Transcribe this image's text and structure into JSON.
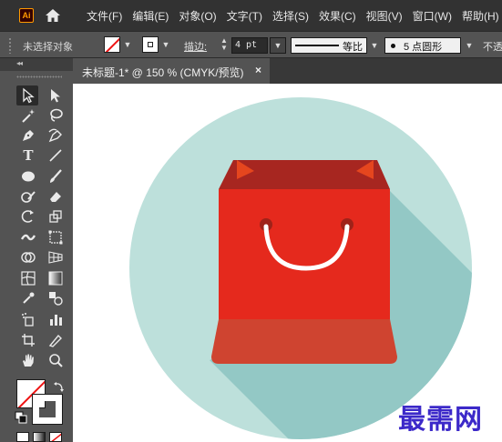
{
  "app": {
    "logo_text": "Ai",
    "menu": [
      "文件(F)",
      "编辑(E)",
      "对象(O)",
      "文字(T)",
      "选择(S)",
      "效果(C)",
      "视图(V)",
      "窗口(W)",
      "帮助(H)"
    ]
  },
  "control_bar": {
    "selection_status": "未选择对象",
    "stroke_label": "描边",
    "stroke_colon": ":",
    "stroke_weight": "4 pt",
    "profile_label": "等比",
    "brush_label": "5 点圆形",
    "opacity_label": "不透"
  },
  "document": {
    "tab_title": "未标题-1* @ 150 % (CMYK/预览)",
    "close_glyph": "×"
  },
  "tools": [
    "selection-tool",
    "direct-selection-tool",
    "magic-wand-tool",
    "lasso-tool",
    "pen-tool",
    "curvature-tool",
    "type-tool",
    "line-segment-tool",
    "ellipse-tool",
    "paintbrush-tool",
    "shaper-tool",
    "eraser-tool",
    "rotate-tool",
    "scale-tool",
    "width-tool",
    "free-transform-tool",
    "shape-builder-tool",
    "perspective-grid-tool",
    "mesh-tool",
    "gradient-tool",
    "eyedropper-tool",
    "blend-tool",
    "symbol-sprayer-tool",
    "column-graph-tool",
    "artboard-tool",
    "slice-tool",
    "hand-tool",
    "zoom-tool"
  ],
  "type_tool_glyph": "T",
  "artwork": {
    "colors": {
      "circle": "#bde0db",
      "shadow": "#93c8c5",
      "bag_body": "#e5291d",
      "bag_top": "#a72620",
      "bag_bottom": "#cf4430",
      "handle": "#ffffff",
      "handle_holes": "#9f2219",
      "fold_triangles": "#e5461e"
    }
  },
  "watermark": "最需网",
  "colors": {
    "menubar": "#323232",
    "panel": "#535353",
    "accent_logo": "#ff9a00",
    "watermark": "#3c29c9"
  }
}
